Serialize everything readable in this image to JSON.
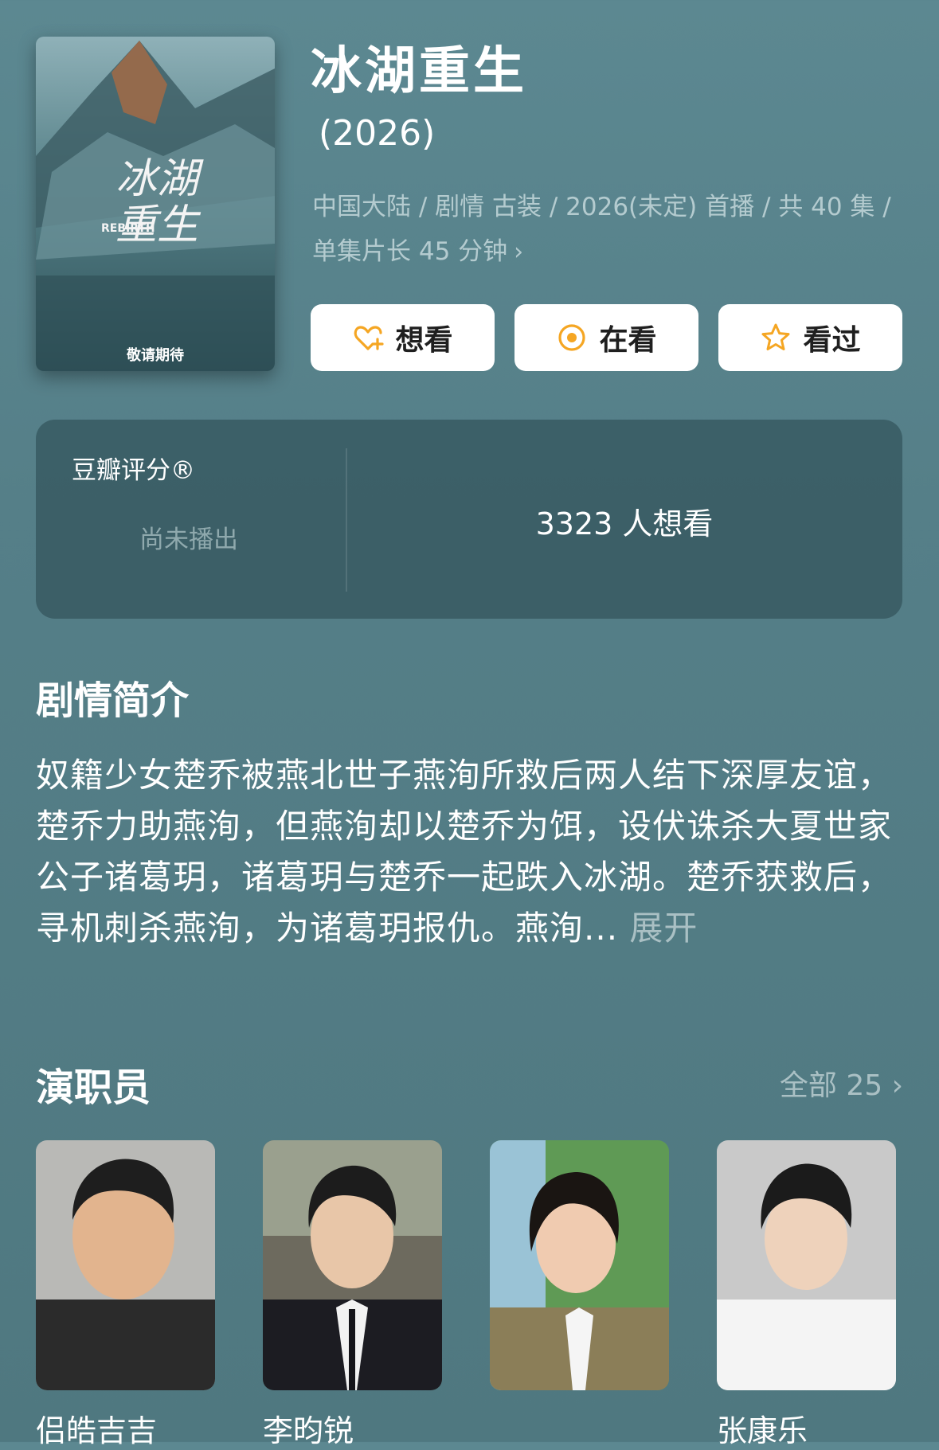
{
  "title": "冰湖重生",
  "year": "(2026)",
  "meta": {
    "line1": "中国大陆 / 剧情 古装 / 2026(未定) 首播 / 共 40 集 /",
    "line2": "单集片长 45 分钟"
  },
  "poster": {
    "title_text": "冰湖重生",
    "subtitle": "REBIRTH",
    "tagline": "敬请期待"
  },
  "buttons": [
    {
      "label": "想看",
      "icon": "heart-plus-icon"
    },
    {
      "label": "在看",
      "icon": "watching-circle-icon"
    },
    {
      "label": "看过",
      "icon": "star-icon"
    }
  ],
  "rating": {
    "label": "豆瓣评分®",
    "status": "尚未播出",
    "want_count": "3323 人想看"
  },
  "synopsis": {
    "heading": "剧情简介",
    "text": "奴籍少女楚乔被燕北世子燕洵所救后两人结下深厚友谊，楚乔力助燕洵，但燕洵却以楚乔为饵，设伏诛杀大夏世家公子诸葛玥，诸葛玥与楚乔一起跌入冰湖。楚乔获救后，寻机刺杀燕洵，为诸葛玥报仇。燕洵...",
    "expand": "展开"
  },
  "cast": {
    "heading": "演职员",
    "all_label": "全部 25",
    "members": [
      {
        "name": "侣皓吉吉"
      },
      {
        "name": "李昀锐"
      },
      {
        "name": ""
      },
      {
        "name": "张康乐"
      }
    ]
  },
  "colors": {
    "accent": "#f5a623",
    "background": "#557f88"
  }
}
